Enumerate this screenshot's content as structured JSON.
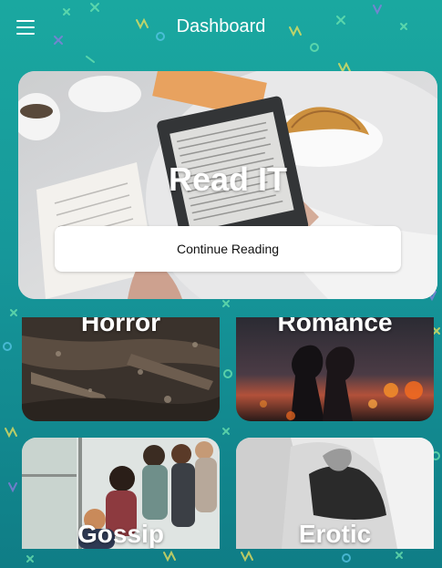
{
  "header": {
    "title": "Dashboard",
    "menu_icon": "hamburger-menu-icon"
  },
  "hero": {
    "title": "Read IT",
    "button_label": "Continue Reading"
  },
  "categories": [
    {
      "label": "Horror"
    },
    {
      "label": "Romance"
    },
    {
      "label": "Gossip"
    },
    {
      "label": "Erotic"
    }
  ],
  "colors": {
    "background_top": "#1aa8a0",
    "background_bottom": "#0f7d86",
    "confetti": [
      "#6fe6b0",
      "#f2e35a",
      "#8f7be0",
      "#59c7e8"
    ]
  }
}
